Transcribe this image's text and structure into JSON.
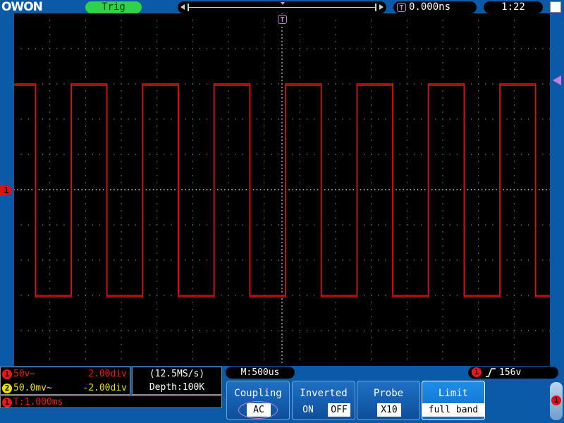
{
  "header": {
    "logo": "OWON",
    "trig_status": "Trig",
    "trigger_position": "0.000ns",
    "trigger_icon": "T",
    "clock": "1:22"
  },
  "colors": {
    "ch1": "#e01010",
    "ch2": "#e8e000",
    "trigger": "#c77ddc",
    "status_ok": "#2fd34a"
  },
  "waveform": {
    "channel": "1",
    "high_level_div": 3.0,
    "low_level_div": -3.0,
    "period_div": 2.0,
    "first_rising_div": 1.6
  },
  "channels": {
    "ch1": {
      "index": "1",
      "coupling": "50v~",
      "volts_div": "2.00div"
    },
    "ch2": {
      "index": "2",
      "coupling": "50.0mv~",
      "volts_div": "-2.00div"
    }
  },
  "sampling": {
    "rate": "(12.5MS/s)",
    "depth": "Depth:100K"
  },
  "timebase": {
    "index": "1",
    "value": "T:1.000ms",
    "main": "M:500us"
  },
  "trigger": {
    "source": "1",
    "edge_icon": "rising-edge-icon",
    "level": "156v"
  },
  "menu": {
    "coupling": {
      "title": "Coupling",
      "value": "AC"
    },
    "inverted": {
      "title": "Inverted",
      "on": "ON",
      "off": "OFF"
    },
    "probe": {
      "title": "Probe",
      "value": "X10"
    },
    "limit": {
      "title": "Limit",
      "value": "full band"
    }
  },
  "side": {
    "channel": "1"
  }
}
